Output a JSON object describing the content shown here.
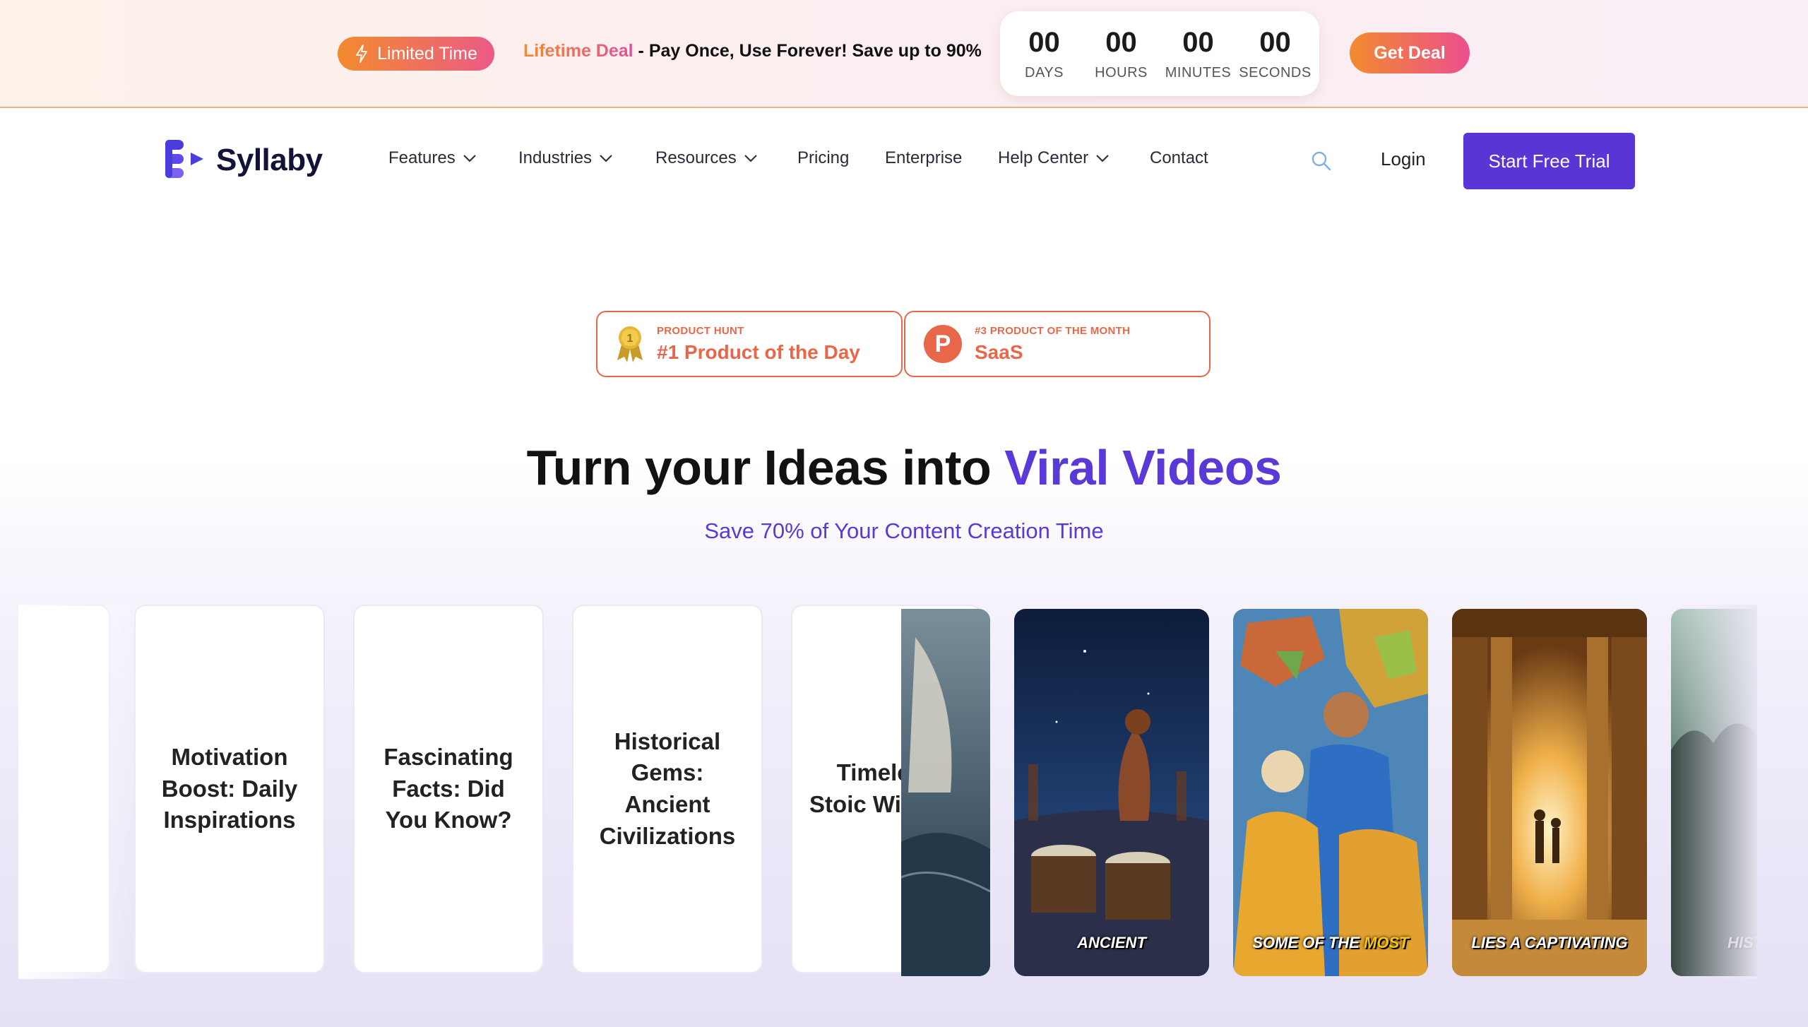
{
  "promo": {
    "limited_label": "Limited Time",
    "deal_label": "Lifetime Deal",
    "deal_text": " - Pay Once, Use Forever! Save up to 90%",
    "countdown": [
      {
        "value": "00",
        "label": "DAYS"
      },
      {
        "value": "00",
        "label": "HOURS"
      },
      {
        "value": "00",
        "label": "MINUTES"
      },
      {
        "value": "00",
        "label": "SECONDS"
      }
    ],
    "cta_label": "Get Deal"
  },
  "nav": {
    "brand": "Syllaby",
    "items": [
      {
        "label": "Features",
        "dropdown": true
      },
      {
        "label": "Industries",
        "dropdown": true
      },
      {
        "label": "Resources",
        "dropdown": true
      },
      {
        "label": "Pricing",
        "dropdown": false
      },
      {
        "label": "Enterprise",
        "dropdown": false
      },
      {
        "label": "Help Center",
        "dropdown": true
      },
      {
        "label": "Contact",
        "dropdown": false
      }
    ],
    "login_label": "Login",
    "trial_label": "Start Free Trial"
  },
  "badges": [
    {
      "kicker": "PRODUCT HUNT",
      "title": "#1 Product of the Day",
      "icon": "medal-icon",
      "medal_number": "1"
    },
    {
      "kicker": "#3 PRODUCT OF THE MONTH",
      "title": "SaaS",
      "icon": "product-hunt-icon",
      "letter": "P"
    }
  ],
  "hero": {
    "title_prefix": "Turn your Ideas into ",
    "title_accent": "Viral Videos",
    "subtitle": "Save 70% of Your Content Creation Time"
  },
  "carousel": {
    "topic_cards": [
      {
        "title": "Motivation Boost: Daily Inspirations"
      },
      {
        "title": "Fascinating Facts: Did You Know?"
      },
      {
        "title": "Historical Gems: Ancient Civilizations"
      },
      {
        "title": "Timeless Stoic Wisdom"
      }
    ],
    "video_cards": [
      {
        "caption": ""
      },
      {
        "caption": "ANCIENT"
      },
      {
        "caption_parts": [
          "SOME ",
          "OF THE ",
          "MOST"
        ]
      },
      {
        "caption": "LIES A CAPTIVATING"
      },
      {
        "caption": "HISTO"
      }
    ]
  },
  "colors": {
    "brand_purple": "#5a35d6",
    "accent_orange": "#f28b2e",
    "badge_red": "#e8674a"
  }
}
